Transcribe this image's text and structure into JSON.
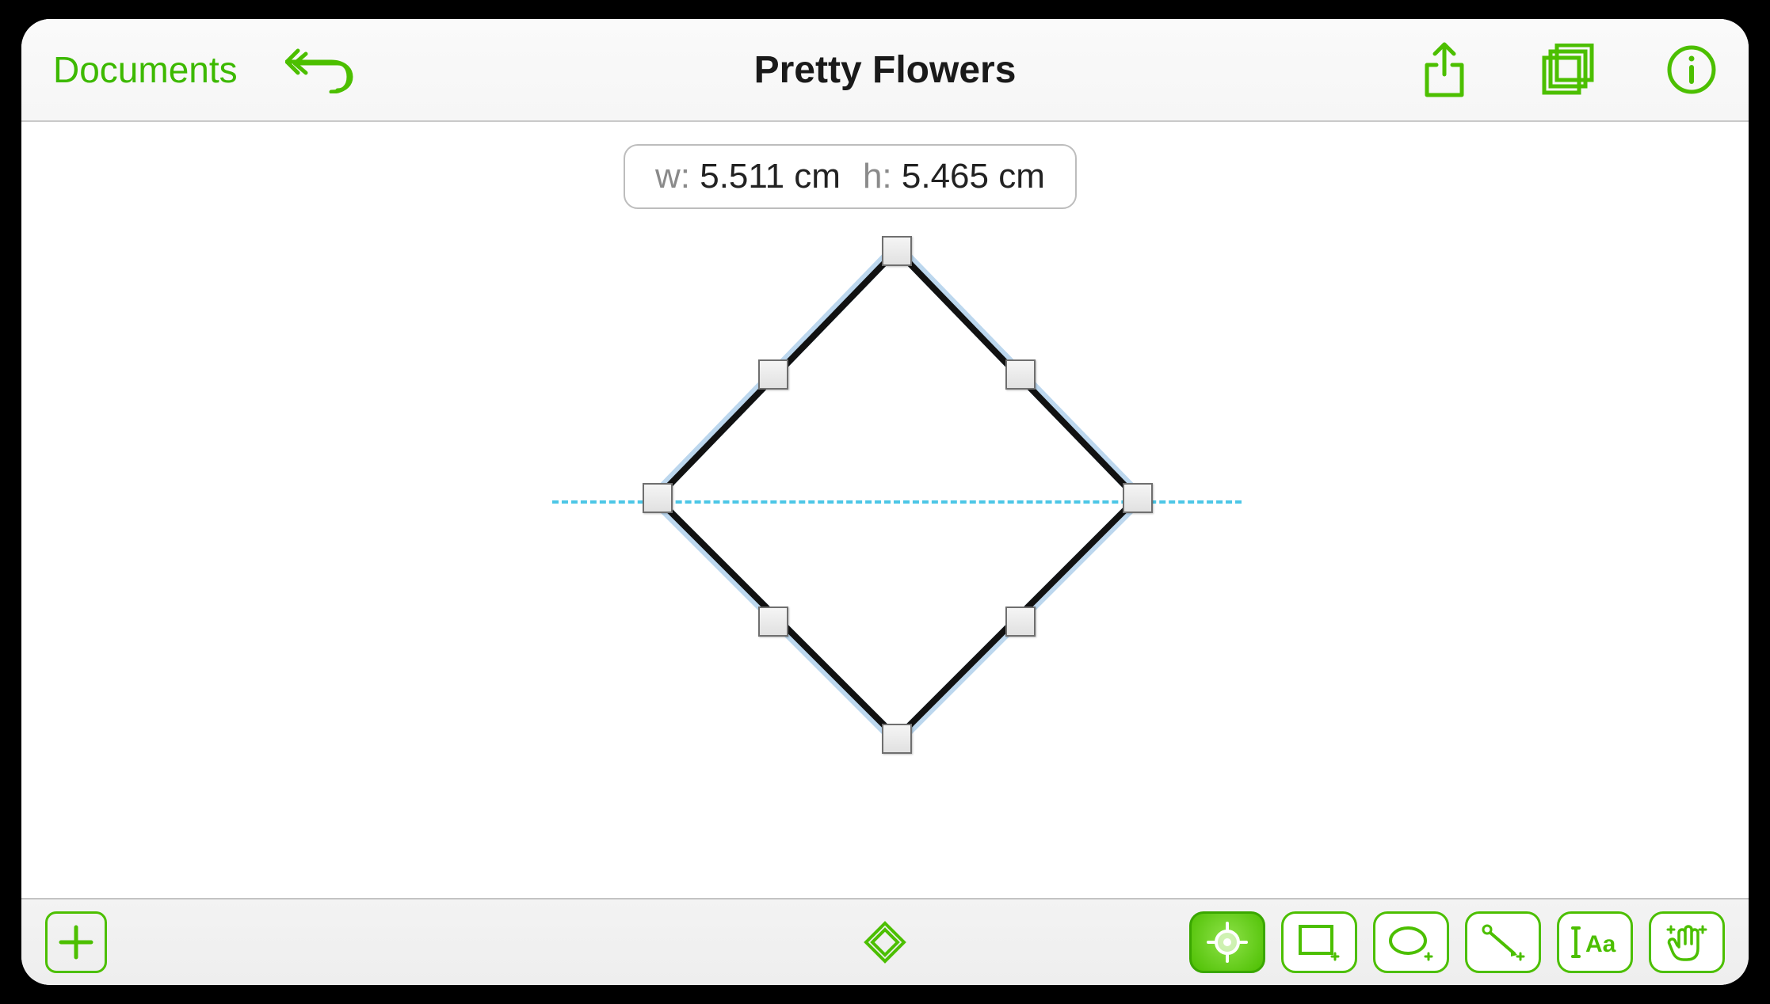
{
  "colors": {
    "accent": "#4cbf00",
    "guide": "#4cc6e6"
  },
  "topbar": {
    "back_label": "Documents",
    "title": "Pretty Flowers",
    "icons": {
      "undo": "undo-icon",
      "share": "share-icon",
      "canvases": "canvases-icon",
      "info": "info-icon"
    }
  },
  "hud": {
    "w_label": "w:",
    "width": "5.511 cm",
    "h_label": "h:",
    "height": "5.465 cm"
  },
  "selection": {
    "shape": "diamond",
    "handles": 8
  },
  "bottombar": {
    "add": "add-shape-button",
    "drawing_mode": "diamond-mode",
    "tools": [
      {
        "name": "selection-tool",
        "icon": "crosshair-icon",
        "selected": true
      },
      {
        "name": "rectangle-tool",
        "icon": "rectangle-icon",
        "selected": false
      },
      {
        "name": "ellipse-tool",
        "icon": "ellipse-icon",
        "selected": false
      },
      {
        "name": "line-tool",
        "icon": "line-icon",
        "selected": false
      },
      {
        "name": "text-tool",
        "icon": "text-icon",
        "selected": false
      },
      {
        "name": "freehand-tool",
        "icon": "hand-icon",
        "selected": false
      }
    ]
  }
}
